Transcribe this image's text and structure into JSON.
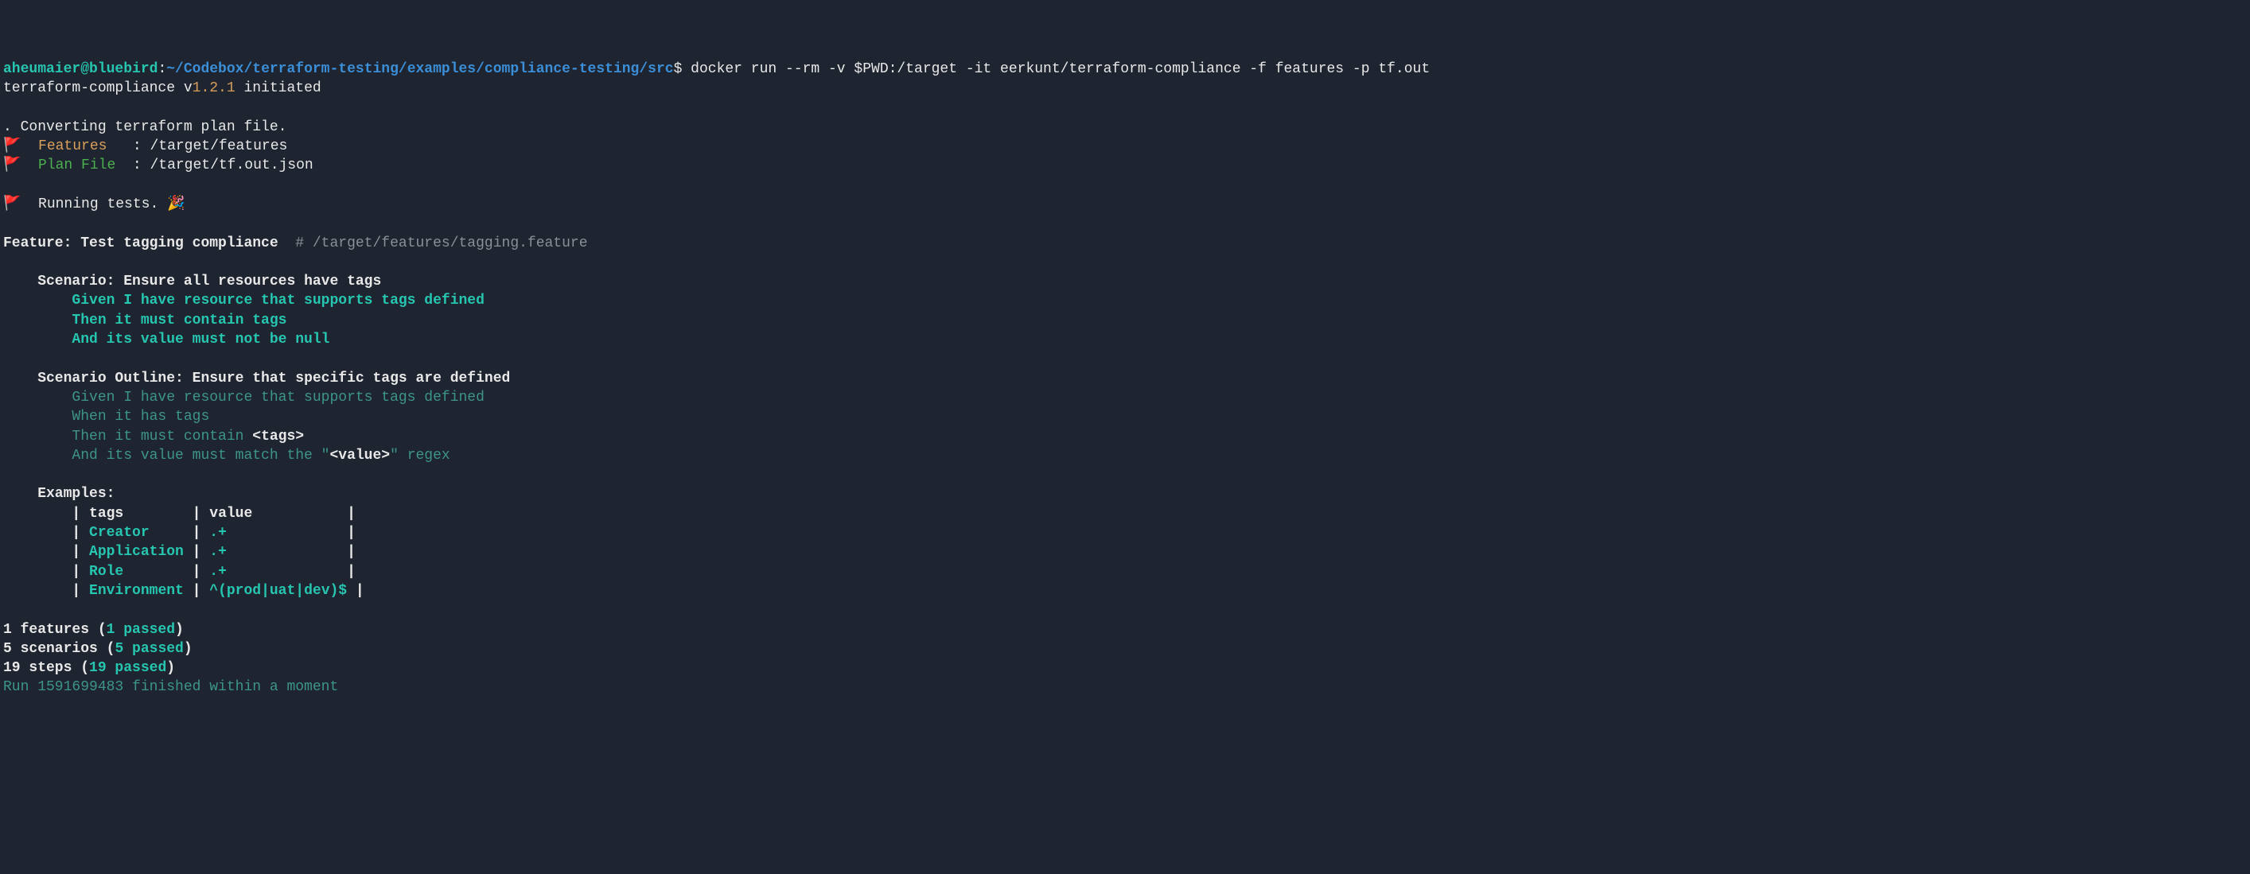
{
  "prompt": {
    "user": "aheumaier@bluebird",
    "colon": ":",
    "path": "~/Codebox/terraform-testing/examples/compliance-testing/src",
    "dollar": "$",
    "command": " docker run --rm -v $PWD:/target -it eerkunt/terraform-compliance -f features -p tf.out"
  },
  "init": {
    "prefix": "terraform-compliance v",
    "version": "1.2.1",
    "suffix": " initiated"
  },
  "convert": ". Converting terraform plan file.",
  "flag": "🚩",
  "features_label": "  Features",
  "features_sep": "   : ",
  "features_path": "/target/features",
  "plan_label": "  Plan File",
  "plan_sep": "  : ",
  "plan_path": "/target/tf.out.json",
  "running": "  Running tests. ",
  "party": "🎉",
  "feature_kw": "Feature: ",
  "feature_title": "Test tagging compliance",
  "feature_comment": "  # /target/features/tagging.feature",
  "scenario1_kw": "    Scenario: ",
  "scenario1_title": "Ensure all resources have tags",
  "s1_line1": "        Given I have resource that supports tags defined",
  "s1_line2": "        Then it must contain tags",
  "s1_line3": "        And its value must not be null",
  "scenario2_kw": "    Scenario Outline: ",
  "scenario2_title": "Ensure that specific tags are defined",
  "s2_line1": "        Given I have resource that supports tags defined",
  "s2_line2": "        When it has tags",
  "s2_line3a": "        Then it must contain ",
  "s2_line3b": "<tags>",
  "s2_line4a": "        And its value must match the \"",
  "s2_line4b": "<value>",
  "s2_line4c": "\" regex",
  "examples_kw": "    Examples:",
  "table_header_pipe": "        | ",
  "table_h1": "tags",
  "table_h1_pad": "        | ",
  "table_h2": "value",
  "table_h2_pad": "           |",
  "row1_tag": "Creator",
  "row1_pad": "     | ",
  "row1_val": ".+",
  "row1_end": "              |",
  "row2_tag": "Application",
  "row2_pad": " | ",
  "row2_val": ".+",
  "row2_end": "              |",
  "row3_tag": "Role",
  "row3_pad": "        | ",
  "row3_val": ".+",
  "row3_end": "              |",
  "row4_tag": "Environment",
  "row4_pad": " | ",
  "row4_val": "^(prod|uat|dev)$",
  "row4_end": " |",
  "summary1a": "1 features (",
  "summary1b": "1 passed",
  "summary1c": ")",
  "summary2a": "5 scenarios (",
  "summary2b": "5 passed",
  "summary2c": ")",
  "summary3a": "19 steps (",
  "summary3b": "19 passed",
  "summary3c": ")",
  "run_line": "Run 1591699483 finished within a moment"
}
